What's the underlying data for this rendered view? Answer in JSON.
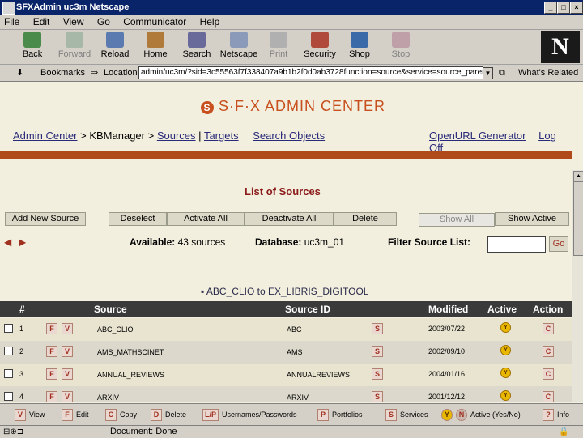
{
  "window": {
    "title": "SFXAdmin uc3m Netscape"
  },
  "menu": [
    "File",
    "Edit",
    "View",
    "Go",
    "Communicator",
    "Help"
  ],
  "toolbar": [
    "Back",
    "Forward",
    "Reload",
    "Home",
    "Search",
    "Netscape",
    "Print",
    "Security",
    "Shop",
    "Stop"
  ],
  "location": {
    "bookmarks_label": "Bookmarks",
    "location_label": "Location",
    "url": "admin/uc3m/?sid=3c55563f7f338407a9b1b2f0d0ab3728function=source&service=source_paren",
    "related_label": "What's Related"
  },
  "page": {
    "brand": "S·F·X ADMIN CENTER",
    "nav": {
      "admin_center": "Admin Center",
      "sep": ">",
      "kbmanager": "KBManager",
      "sources": "Sources",
      "pipe": "|",
      "targets": "Targets",
      "search_objects": "Search Objects",
      "openurl": "OpenURL Generator",
      "logoff": "Log Off"
    },
    "heading": "List of Sources",
    "buttons": {
      "add": "Add New Source",
      "deselect": "Deselect",
      "activate_all": "Activate All",
      "deactivate_all": "Deactivate All",
      "delete": "Delete",
      "show_all": "Show All",
      "show_active": "Show Active"
    },
    "filter": {
      "available_label": "Available:",
      "available_value": "43 sources",
      "database_label": "Database:",
      "database_value": "uc3m_01",
      "filter_label": "Filter Source List:",
      "go": "Go"
    },
    "range_label": "▪ ABC_CLIO to EX_LIBRIS_DIGITOOL",
    "table": {
      "headers": [
        "#",
        "Source",
        "Source ID",
        "Modified",
        "Active",
        "Action"
      ],
      "rows": [
        {
          "num": "1",
          "source": "ABC_CLIO",
          "id": "ABC",
          "modified": "2003/07/22"
        },
        {
          "num": "2",
          "source": "AMS_MATHSCINET",
          "id": "AMS",
          "modified": "2002/09/10"
        },
        {
          "num": "3",
          "source": "ANNUAL_REVIEWS",
          "id": "ANNUALREVIEWS",
          "modified": "2004/01/16"
        },
        {
          "num": "4",
          "source": "ARXIV",
          "id": "ARXIV",
          "modified": "2001/12/12"
        }
      ]
    },
    "row_actions": {
      "f": "F",
      "v": "V",
      "s": "S",
      "y": "Y",
      "c": "C"
    }
  },
  "legend": [
    {
      "key": "V",
      "label": "View"
    },
    {
      "key": "F",
      "label": "Edit"
    },
    {
      "key": "C",
      "label": "Copy"
    },
    {
      "key": "D",
      "label": "Delete"
    },
    {
      "key": "L/P",
      "label": "Usernames/Passwords"
    },
    {
      "key": "P",
      "label": "Portfolios"
    },
    {
      "key": "S",
      "label": "Services"
    },
    {
      "key": "Y",
      "key2": "N",
      "label": "Active (Yes/No)"
    },
    {
      "key": "?",
      "label": "Info"
    }
  ],
  "status": {
    "text": "Document: Done"
  },
  "colors": {
    "titlebar": "#0a246a",
    "accent": "#c8501e",
    "header": "#3a3a3a",
    "page_bg": "#f2efde"
  }
}
